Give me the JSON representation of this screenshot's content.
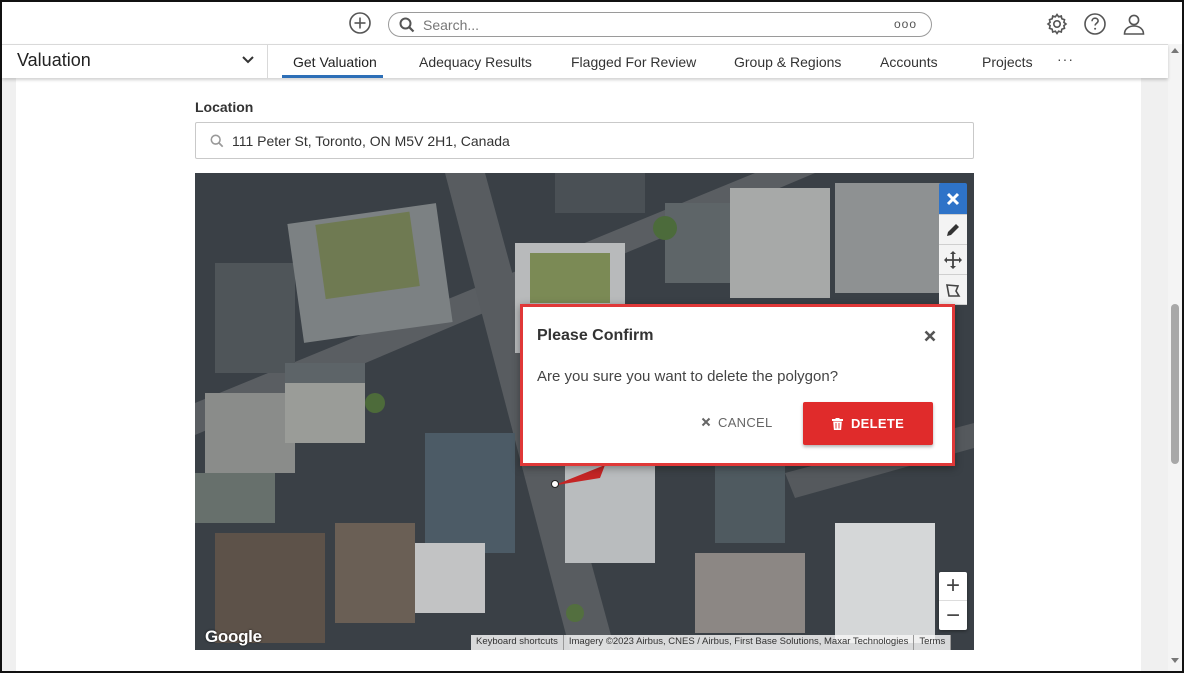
{
  "topbar": {
    "search_placeholder": "Search...",
    "search_more": "ooo",
    "icons": [
      "add-circle-icon",
      "search-icon",
      "gear-icon",
      "help-icon",
      "user-icon"
    ]
  },
  "nav": {
    "module": "Valuation",
    "tabs": [
      {
        "label": "Get Valuation",
        "active": true
      },
      {
        "label": "Adequacy Results"
      },
      {
        "label": "Flagged For Review"
      },
      {
        "label": "Group & Regions"
      },
      {
        "label": "Accounts"
      },
      {
        "label": "Projects"
      }
    ],
    "more": "···"
  },
  "location": {
    "label": "Location",
    "value": "111 Peter St, Toronto, ON M5V 2H1, Canada"
  },
  "map": {
    "logo": "Google",
    "attribution": [
      "Keyboard shortcuts",
      "Imagery ©2023 Airbus, CNES / Airbus, First Base Solutions, Maxar Technologies",
      "Terms"
    ],
    "tools": [
      "close-icon",
      "pencil-icon",
      "move-icon",
      "polygon-edit-icon"
    ],
    "zoom_in": "+",
    "zoom_out": "−"
  },
  "dialog": {
    "title": "Please Confirm",
    "message": "Are you sure you want to delete the polygon?",
    "cancel_label": "CANCEL",
    "delete_label": "DELETE",
    "accent": "#e02b2b"
  }
}
